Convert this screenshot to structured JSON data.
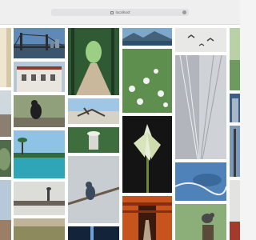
{
  "browser": {
    "url": "localhost"
  },
  "gallery": {
    "images": [
      {
        "name": "partial-left-top"
      },
      {
        "name": "bridge-skyline"
      },
      {
        "name": "forest-boardwalk"
      },
      {
        "name": "mountain-lake"
      },
      {
        "name": "birds-in-flight"
      },
      {
        "name": "partial-right-top"
      },
      {
        "name": "white-building"
      },
      {
        "name": "wildflower-meadow"
      },
      {
        "name": "modern-architecture"
      },
      {
        "name": "partial-left-mid"
      },
      {
        "name": "bird-on-rock"
      },
      {
        "name": "driftwood-beach"
      },
      {
        "name": "white-flower"
      },
      {
        "name": "partial-right-mid"
      },
      {
        "name": "palm-beach"
      },
      {
        "name": "garden-fountain"
      },
      {
        "name": "coastal-aerial"
      },
      {
        "name": "partial-left-low"
      },
      {
        "name": "heron-on-pier"
      },
      {
        "name": "small-bird-branch"
      },
      {
        "name": "torii-tunnel"
      },
      {
        "name": "bird-on-stump"
      },
      {
        "name": "partial-right-low"
      },
      {
        "name": "grassland-path"
      },
      {
        "name": "night-sky"
      }
    ]
  }
}
